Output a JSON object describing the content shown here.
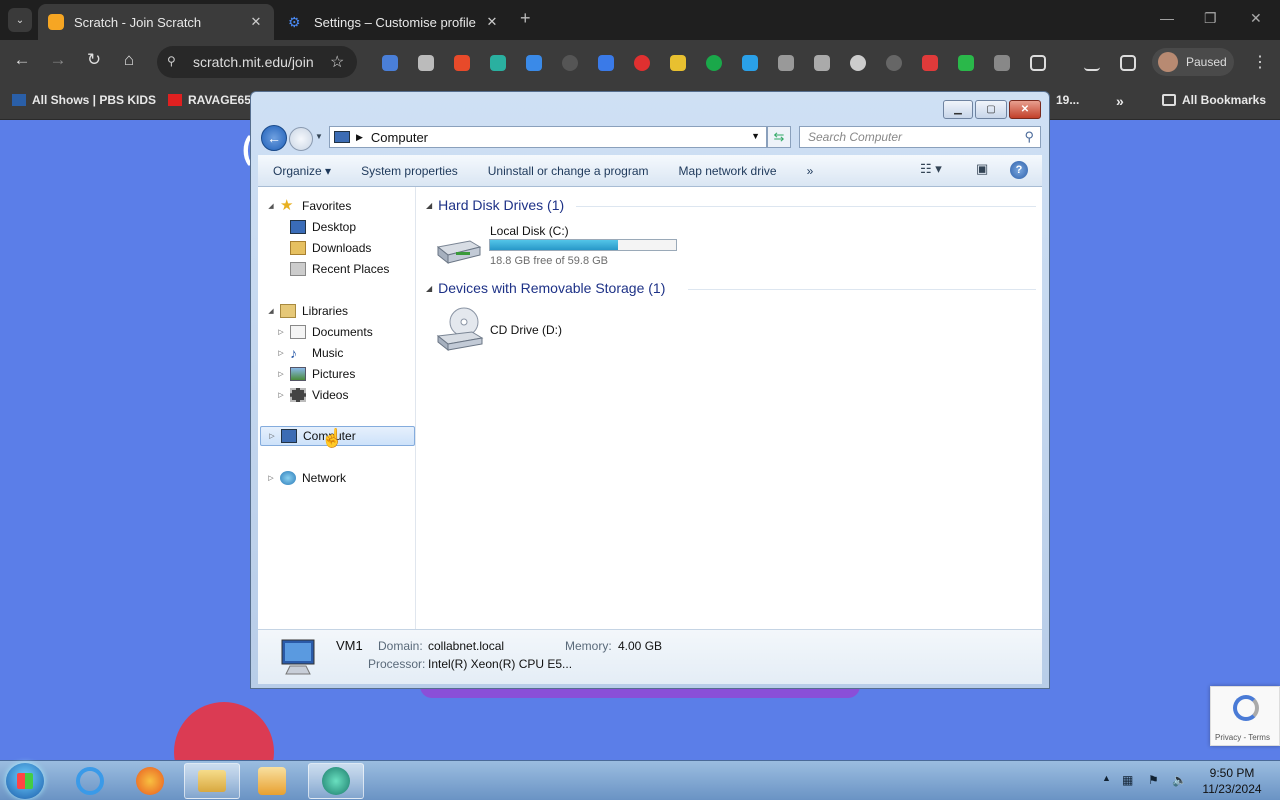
{
  "browser": {
    "tabs": [
      {
        "title": "Scratch - Join Scratch",
        "active": true
      },
      {
        "title": "Settings – Customise profile",
        "active": false
      }
    ],
    "url": "scratch.mit.edu/join",
    "profile_label": "Paused",
    "bookmarks": [
      {
        "label": "All Shows | PBS KIDS"
      },
      {
        "label": "RAVAGE657"
      },
      {
        "label": "19..."
      },
      {
        "label": "All Bookmarks"
      }
    ]
  },
  "page": {
    "recaptcha_footer": "Privacy - Terms"
  },
  "explorer": {
    "address": "Computer",
    "search_placeholder": "Search Computer",
    "toolbar": {
      "organize": "Organize",
      "system_properties": "System properties",
      "uninstall": "Uninstall or change a program",
      "map_drive": "Map network drive",
      "more": "»"
    },
    "nav": {
      "favorites": "Favorites",
      "desktop": "Desktop",
      "downloads": "Downloads",
      "recent": "Recent Places",
      "libraries": "Libraries",
      "documents": "Documents",
      "music": "Music",
      "pictures": "Pictures",
      "videos": "Videos",
      "computer": "Computer",
      "network": "Network"
    },
    "groups": {
      "hdd": "Hard Disk Drives (1)",
      "removable": "Devices with Removable Storage (1)"
    },
    "drives": {
      "c_name": "Local Disk (C:)",
      "c_free": "18.8 GB free of 59.8 GB",
      "c_used_fraction": 0.686,
      "d_name": "CD Drive (D:)"
    },
    "details": {
      "name": "VM1",
      "domain_label": "Domain:",
      "domain": "collabnet.local",
      "memory_label": "Memory:",
      "memory": "4.00 GB",
      "processor_label": "Processor:",
      "processor": "Intel(R) Xeon(R) CPU E5..."
    }
  },
  "taskbar": {
    "time": "9:50 PM",
    "date": "11/23/2024"
  }
}
